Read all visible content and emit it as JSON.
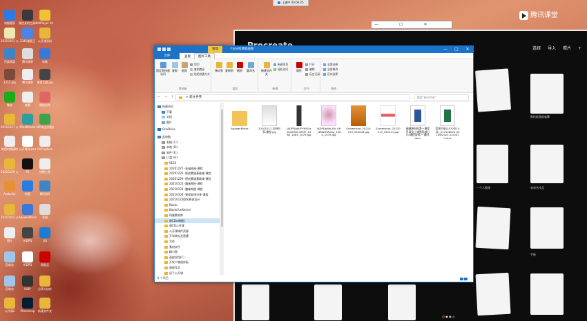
{
  "desktop": {
    "icons": [
      {
        "label": "电脑管家",
        "color": "#2a7be4"
      },
      {
        "label": "微信关机工具exe",
        "color": "#3a3a3a"
      },
      {
        "label": "PotPlayer 64 bit",
        "color": "#f1c232"
      },
      {
        "label": "20210201 公开课",
        "color": "#efe7b0"
      },
      {
        "label": "2345看图王",
        "color": "#4a86e8"
      },
      {
        "label": "公开课资料",
        "color": "#e8b73a"
      },
      {
        "label": "百度网盘",
        "color": "#3d85c6"
      },
      {
        "label": "腾讯课堂",
        "color": "#ddd"
      },
      {
        "label": "电脑",
        "color": "#3c78d8"
      },
      {
        "label": "1212.jpg",
        "color": "#7a4a3a"
      },
      {
        "label": "腾讯课堂",
        "color": "#eee"
      },
      {
        "label": "课程大纲.jpg",
        "color": "#444"
      },
      {
        "label": "微信",
        "color": "#1aad19"
      },
      {
        "label": "查看",
        "color": "#eee"
      },
      {
        "label": "微信文件",
        "color": "#e06666"
      },
      {
        "label": "20210127 公开课",
        "color": "#e8b73a"
      },
      {
        "label": "MindMaster",
        "color": "#2c9ea0"
      },
      {
        "label": "360安全浏览器",
        "color": "#3ea34d"
      },
      {
        "label": "韩国时装模特",
        "color": "#eee"
      },
      {
        "label": "公开课2point",
        "color": "#fff"
      },
      {
        "label": "EVCapture",
        "color": "#eee"
      },
      {
        "label": "20210129 公开课",
        "color": "#e8b73a"
      },
      {
        "label": "PS",
        "color": "#111"
      },
      {
        "label": "快捷工具",
        "color": "#eee"
      },
      {
        "label": "Audacity",
        "color": "#e69138"
      },
      {
        "label": "地图",
        "color": "#2a7be4"
      },
      {
        "label": "腾讯QQ",
        "color": "#3d85c6"
      },
      {
        "label": "20210203 公开课",
        "color": "#e8b73a"
      },
      {
        "label": "ApowerMirror",
        "color": "#3c78d8"
      },
      {
        "label": "草图",
        "color": "#ddd"
      },
      {
        "label": "图片",
        "color": "#eee"
      },
      {
        "label": "IADPD",
        "color": "#444"
      },
      {
        "label": "QQ",
        "color": "#1c7bd6"
      },
      {
        "label": "回收站",
        "color": "#9fc5e8"
      },
      {
        "label": "IADPD",
        "color": "#fff"
      },
      {
        "label": "网易云",
        "color": "#c00"
      },
      {
        "label": "回收站",
        "color": "#9fc5e8"
      },
      {
        "label": "IADP",
        "color": "#333"
      },
      {
        "label": "分享与协作",
        "color": "#e8b73a"
      },
      {
        "label": "公开课2",
        "color": "#e8b73a"
      },
      {
        "label": "Photoshop",
        "color": "#001d34"
      },
      {
        "label": "新建文件夹",
        "color": "#e8b73a"
      },
      {
        "label": "公开课资料",
        "color": "#e8b73a"
      }
    ]
  },
  "top_indicator": {
    "text": "上课中 00:06:25"
  },
  "small_window": {
    "controls": "— ▢ ✕"
  },
  "brand": {
    "name": "腾讯课堂"
  },
  "procreate": {
    "title": "Procreate",
    "nav": [
      "选择",
      "导入",
      "照片",
      "+"
    ],
    "card_labels": [
      "数绘板画板临摹",
      "一个人画课",
      "未命名作品",
      "手账"
    ]
  },
  "explorer": {
    "context_tab": "管理",
    "title": "Flyfe科课笔画图",
    "window_controls": [
      "—",
      "▢",
      "✕"
    ],
    "ribbon_tabs": [
      "文件",
      "主页",
      "共享",
      "查看",
      "图片工具"
    ],
    "groups": {
      "clipboard": {
        "label": "剪贴板",
        "pin": "固定到快速访问",
        "copy": "复制",
        "paste": "粘贴",
        "cut": "剪切",
        "copy_path": "复制路径",
        "paste_shortcut": "粘贴快捷方式"
      },
      "organize": {
        "label": "组织",
        "move_to": "移动到",
        "copy_to": "复制到",
        "delete": "删除",
        "rename": "重命名"
      },
      "new": {
        "label": "新建",
        "new_folder": "新建文件夹",
        "new_item": "新建项目",
        "easy_access": "轻松访问"
      },
      "open": {
        "label": "打开",
        "properties": "属性",
        "open": "打开",
        "edit": "编辑",
        "history": "历史记录"
      },
      "select": {
        "label": "选择",
        "select_all": "全部选择",
        "select_none": "全部取消",
        "invert": "反向选择"
      }
    },
    "address": {
      "nav": "← → ↑",
      "path": "> 新文件夹",
      "search": "搜索\"新文件夹\""
    },
    "nav_items": [
      {
        "label": "快速访问",
        "type": "star"
      },
      {
        "label": "下载",
        "type": "dl"
      },
      {
        "label": "文档",
        "type": "doc"
      },
      {
        "label": "图片",
        "type": "pic"
      },
      {
        "label": "OneDrive",
        "type": "cloud"
      },
      {
        "label": "此电脑",
        "type": "pc"
      },
      {
        "label": "系统 (C:)",
        "type": "drive"
      },
      {
        "label": "本地 (D:)",
        "type": "drive"
      },
      {
        "label": "软件 (E:)",
        "type": "drive"
      },
      {
        "label": "U 盘 (G:)",
        "type": "drive"
      },
      {
        "label": "0122",
        "type": "folder"
      },
      {
        "label": "20201225 -圣诞插画-课程",
        "type": "folder"
      },
      {
        "label": "20201226 -原创素描基础课-课程",
        "type": "folder"
      },
      {
        "label": "20201229 -原创素描基础课-课程",
        "type": "folder"
      },
      {
        "label": "20210101 -趣味图形-课程",
        "type": "folder"
      },
      {
        "label": "20210103 -趣味构图-课程",
        "type": "folder"
      },
      {
        "label": "20210106 -课程安排分享-课程",
        "type": "folder"
      },
      {
        "label": "20210122欧风原创设计",
        "type": "folder"
      },
      {
        "label": "Baidu",
        "type": "folder"
      },
      {
        "label": "BaiduYunKernel",
        "type": "folder"
      },
      {
        "label": "科普素材库",
        "type": "folder"
      },
      {
        "label": "课CDsd教程",
        "type": "folder"
      },
      {
        "label": "课CD公开课",
        "type": "folder"
      },
      {
        "label": "公开课课件资源",
        "type": "folder"
      },
      {
        "label": "开学典礼及直播",
        "type": "folder"
      },
      {
        "label": "写作",
        "type": "folder"
      },
      {
        "label": "素材文件",
        "type": "folder"
      },
      {
        "label": "精小图",
        "type": "folder"
      },
      {
        "label": "面部应用(C)",
        "type": "folder"
      },
      {
        "label": "开发人物创作板",
        "type": "folder"
      },
      {
        "label": "课程作品",
        "type": "folder"
      },
      {
        "label": "初了公开课",
        "type": "folder"
      }
    ],
    "selected_nav": "课CDsd教程",
    "files": [
      {
        "name": "ApowerMirror",
        "kind": "folder"
      },
      {
        "name": "20201017-五林分享-课程.jpg",
        "kind": "photo"
      },
      {
        "name": "IADPDg8UFVK9I1aZd4HNmYJFMF_5460_1080_1079.jpg",
        "kind": "remote"
      },
      {
        "name": "IADPDpWb_BV_V6_N8WHfWk0g_1080_1079.jpg",
        "kind": "photo2"
      },
      {
        "name": "Screenshot_20210113_162006.jpg",
        "kind": "orange"
      },
      {
        "name": "Screenshot_20210113_162221.jpg",
        "kind": "shot"
      },
      {
        "name": "福建原材料第一课程目录及上课图形部分(3)课程安排-一课时.docx",
        "kind": "word"
      },
      {
        "name": "信息目录(2020年10月)_0171480221/0108/2021-12/0410.xlsx",
        "kind": "excel"
      }
    ],
    "status": "8 个项目"
  },
  "taskbar": {
    "text": "凸 ● ▣ ◎"
  }
}
